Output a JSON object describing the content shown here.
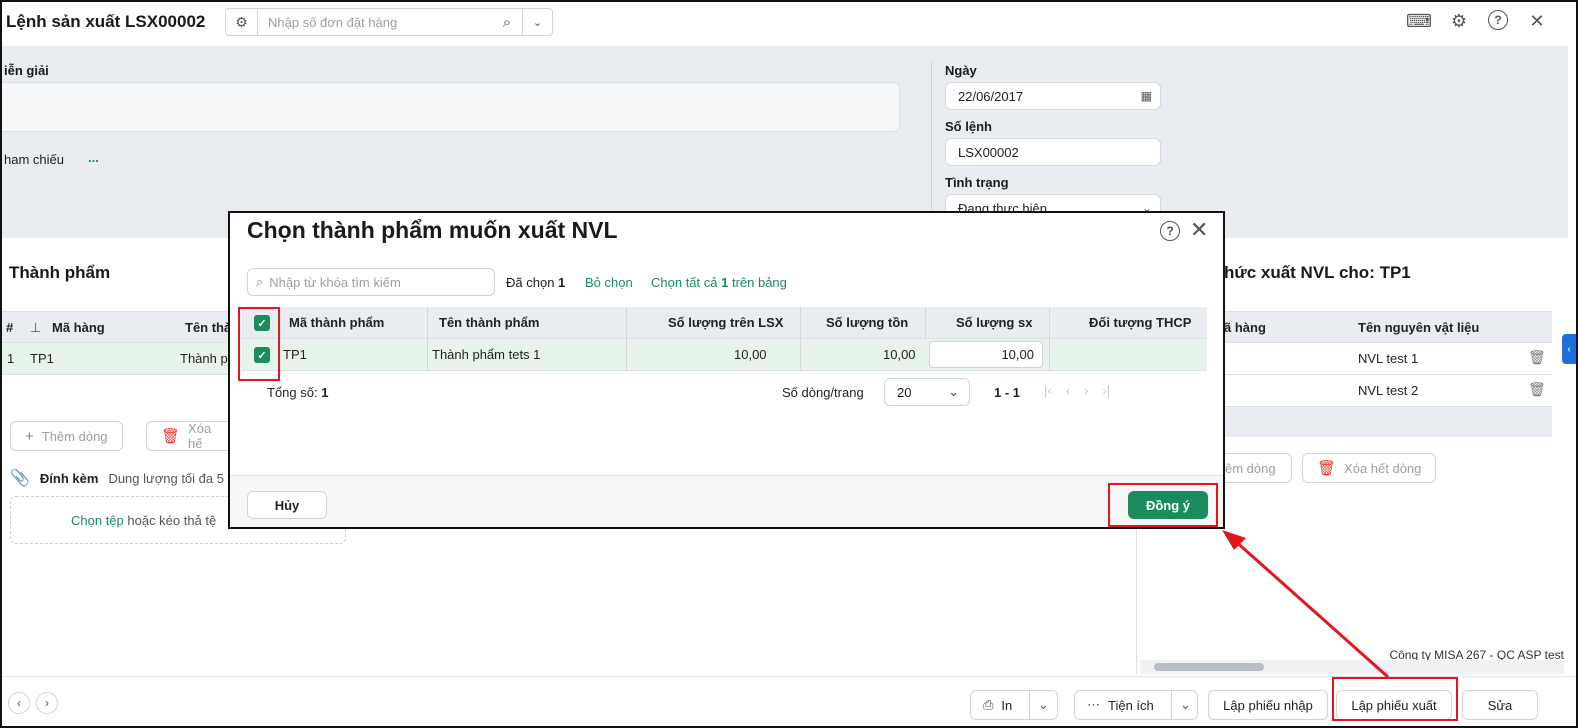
{
  "header": {
    "title": "Lệnh sản xuất LSX00002",
    "search_placeholder": "Nhập số đơn đặt hàng"
  },
  "info": {
    "description_label": "iễn giải",
    "reference_label": "ham chiếu",
    "reference_more": "...",
    "date_label": "Ngày",
    "date_value": "22/06/2017",
    "order_no_label": "Số lệnh",
    "order_no_value": "LSX00002",
    "status_label": "Tình trạng",
    "status_value": "Đang thực hiện"
  },
  "products": {
    "title": "Thành phẩm",
    "columns": [
      "#",
      "Mã hàng",
      "Tên thà"
    ],
    "row": {
      "index": "1",
      "code": "TP1",
      "name": "Thành p"
    },
    "add_row": "Thêm dòng",
    "delete_all": "Xóa hế",
    "attach_label": "Đính kèm",
    "attach_hint": "Dung lượng tối đa 5",
    "drop_link": "Chọn tệp",
    "drop_text": " hoặc kéo thả tệ"
  },
  "materials": {
    "title": "hức xuất NVL cho: TP1",
    "columns": [
      "ã hàng",
      "Tên nguyên vật liệu"
    ],
    "rows": [
      "NVL test 1",
      "NVL test 2"
    ],
    "add_row": "êm dòng",
    "delete_all": "Xóa hết dòng"
  },
  "company": "Công ty MISA 267 - QC ASP test",
  "footer": {
    "print": "In",
    "utilities": "Tiện ích",
    "create_receipt": "Lập phiếu nhập",
    "create_issue": "Lập phiếu xuất",
    "edit": "Sửa"
  },
  "modal": {
    "title": "Chọn thành phẩm muốn xuất NVL",
    "search_placeholder": "Nhập từ khóa tìm kiếm",
    "selected_prefix": "Đã chọn ",
    "selected_count": "1",
    "deselect": "Bỏ chọn",
    "select_all_prefix": "Chọn tất cả ",
    "select_all_count": "1",
    "select_all_suffix": " trên bảng",
    "columns": {
      "code": "Mã thành phẩm",
      "name": "Tên thành phẩm",
      "qty_lsx": "Số lượng trên LSX",
      "qty_stock": "Số lượng tồn",
      "qty_prod": "Số lượng sx",
      "cost_object": "Đối tượng THCP"
    },
    "row": {
      "code": "TP1",
      "name": "Thành phẩm tets 1",
      "qty_lsx": "10,00",
      "qty_stock": "10,00",
      "qty_prod": "10,00",
      "cost_object": ""
    },
    "total_label": "Tổng số: ",
    "total_value": "1",
    "rows_per_page_label": "Số dòng/trang",
    "rows_per_page": "20",
    "range": "1 - 1",
    "cancel": "Hủy",
    "ok": "Đồng ý"
  },
  "colors": {
    "accent": "#1a8c5e",
    "annotation": "#e3171b"
  }
}
